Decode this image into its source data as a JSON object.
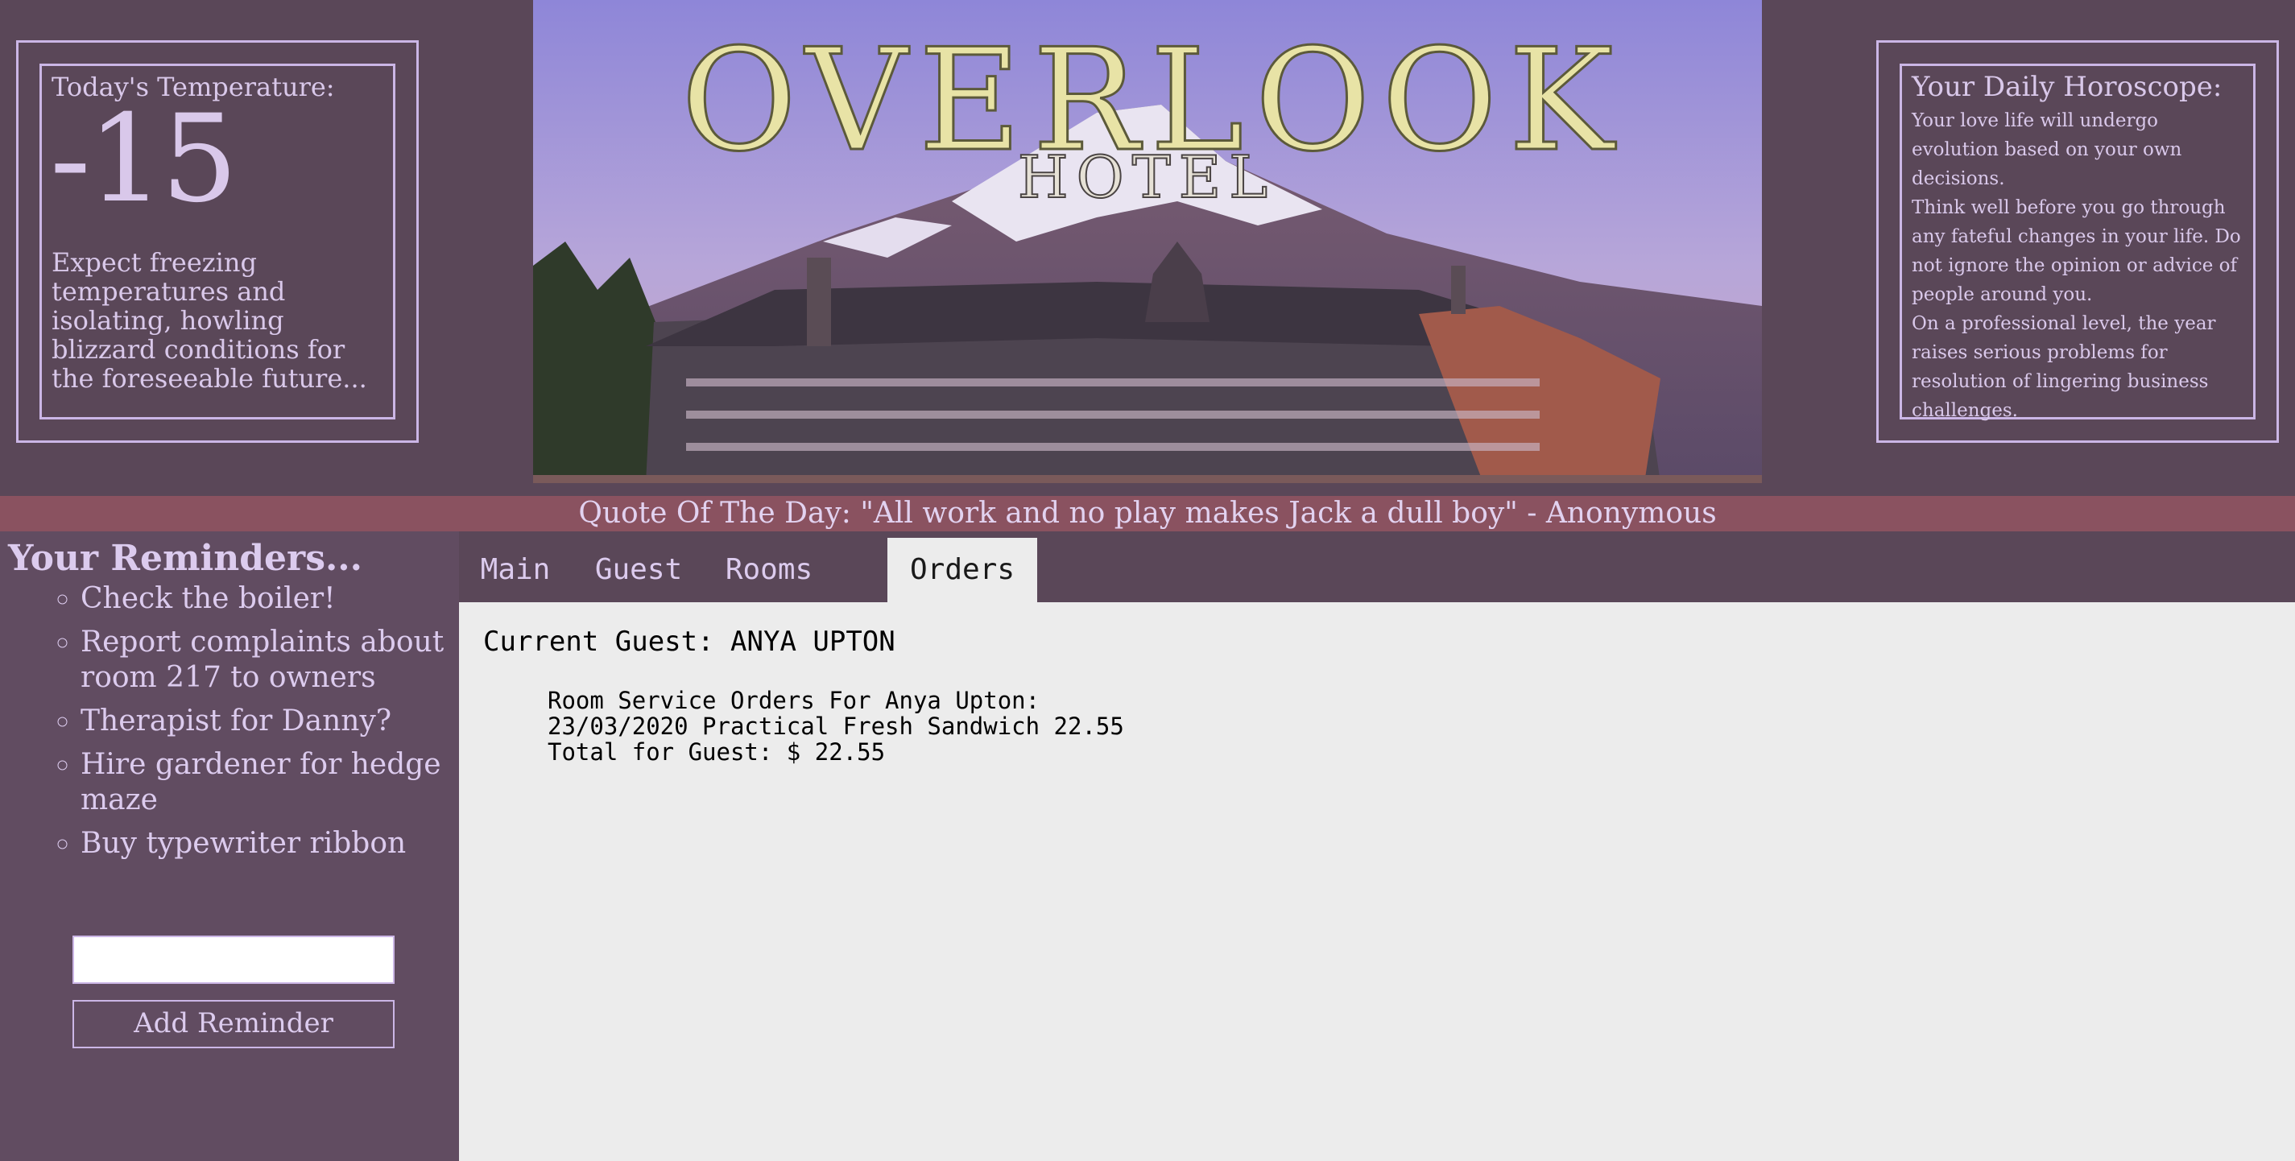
{
  "temperature": {
    "label": "Today's Temperature:",
    "value": "-15",
    "description": "Expect freezing temperatures and isolating, howling blizzard conditions for the foreseeable future..."
  },
  "banner": {
    "title": "OVERLOOK",
    "subtitle": "HOTEL"
  },
  "horoscope": {
    "title": "Your Daily Horoscope:",
    "paragraphs": [
      "Your love life will undergo evolution based on your own decisions.",
      "Think well before you go through any fateful changes in your life. Do not ignore the opinion or advice of people around you.",
      "On a professional level, the year raises serious problems for resolution of lingering business challenges."
    ]
  },
  "quote": "Quote Of The Day: \"All work and no play makes Jack a dull boy\" - Anonymous",
  "reminders": {
    "title": "Your Reminders...",
    "items": [
      "Check the boiler!",
      "Report complaints about room 217 to owners",
      "Therapist for Danny?",
      "Hire gardener for hedge maze",
      "Buy typewriter ribbon"
    ],
    "input_value": "",
    "button_label": "Add Reminder"
  },
  "tabs": [
    {
      "label": "Main",
      "active": false
    },
    {
      "label": "Guest",
      "active": false
    },
    {
      "label": "Rooms",
      "active": false
    },
    {
      "label": "Orders",
      "active": true
    }
  ],
  "orders": {
    "current_guest_label": "Current Guest: ANYA UPTON",
    "heading": "Room Service Orders For Anya Upton:",
    "lines": [
      "23/03/2020 Practical Fresh Sandwich 22.55"
    ],
    "total": "Total for Guest: $ 22.55"
  },
  "colors": {
    "background": "#5a4758",
    "sidebar": "#614c61",
    "quote_bar": "#8a5260",
    "accent_text": "#dccbee",
    "content_bg": "#ececec"
  }
}
